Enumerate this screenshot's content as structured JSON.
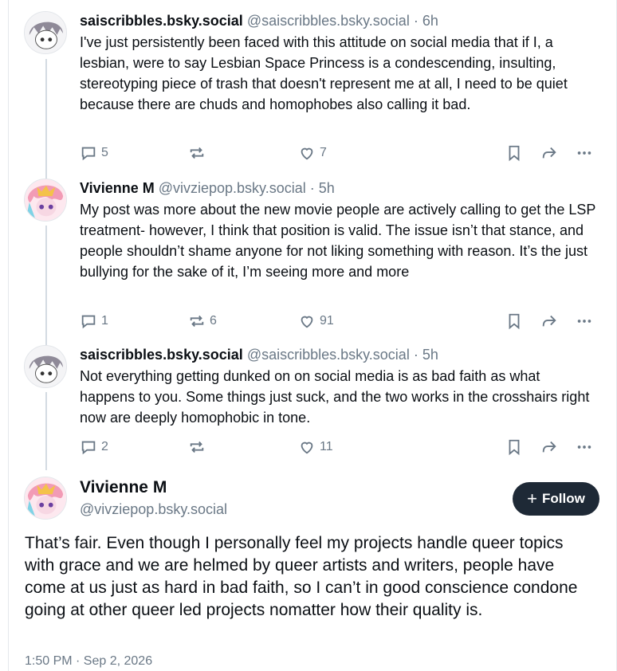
{
  "thread": {
    "replies": [
      {
        "author_name": "saiscribbles.bsky.social",
        "handle": "@saiscribbles.bsky.social",
        "separator": "·",
        "time": "6h",
        "text": "I've just persistently been faced with this attitude on social media that if I, a lesbian, were to say Lesbian Space Princess is a condescending, insulting, stereotyping piece of trash that doesn't represent me at all, I need to be quiet because there are chuds and homophobes also calling it bad.",
        "replies_count": "5",
        "reposts_count": "",
        "likes_count": "7"
      },
      {
        "author_name": "Vivienne M",
        "handle": "@vivziepop.bsky.social",
        "separator": "·",
        "time": "5h",
        "text": "My post was more about the new movie people are actively calling to get the LSP treatment- however, I think that position is valid. The issue isn’t that stance, and people shouldn’t shame anyone for not liking something with reason. It’s the just bullying for the sake of it, I’m seeing more and more",
        "replies_count": "1",
        "reposts_count": "6",
        "likes_count": "91"
      },
      {
        "author_name": "saiscribbles.bsky.social",
        "handle": "@saiscribbles.bsky.social",
        "separator": "·",
        "time": "5h",
        "text": "Not everything getting dunked on on social media is as bad faith as what happens to you. Some things just suck, and the two works in the crosshairs right now are deeply homophobic in tone.",
        "replies_count": "2",
        "reposts_count": "",
        "likes_count": "11"
      }
    ]
  },
  "main_post": {
    "author_name": "Vivienne M",
    "handle": "@vivziepop.bsky.social",
    "follow_label": "Follow",
    "follow_icon": "+",
    "text": "That’s fair. Even though I personally feel my projects handle queer topics with grace and we are helmed by queer artists and writers, people have come at us just as hard in bad faith, so I can’t in good conscience condone going at other queer led projects nomatter how their quality is.",
    "timestamp": "1:50 PM · Sep 2, 2026"
  },
  "colors": {
    "text": "#0b0f14",
    "muted": "#6a7886",
    "follow_bg": "#1e2936",
    "thread_line": "#d4dbe2"
  },
  "icons": [
    "reply-icon",
    "repost-icon",
    "like-icon",
    "bookmark-icon",
    "share-icon",
    "more-icon",
    "plus-icon"
  ]
}
